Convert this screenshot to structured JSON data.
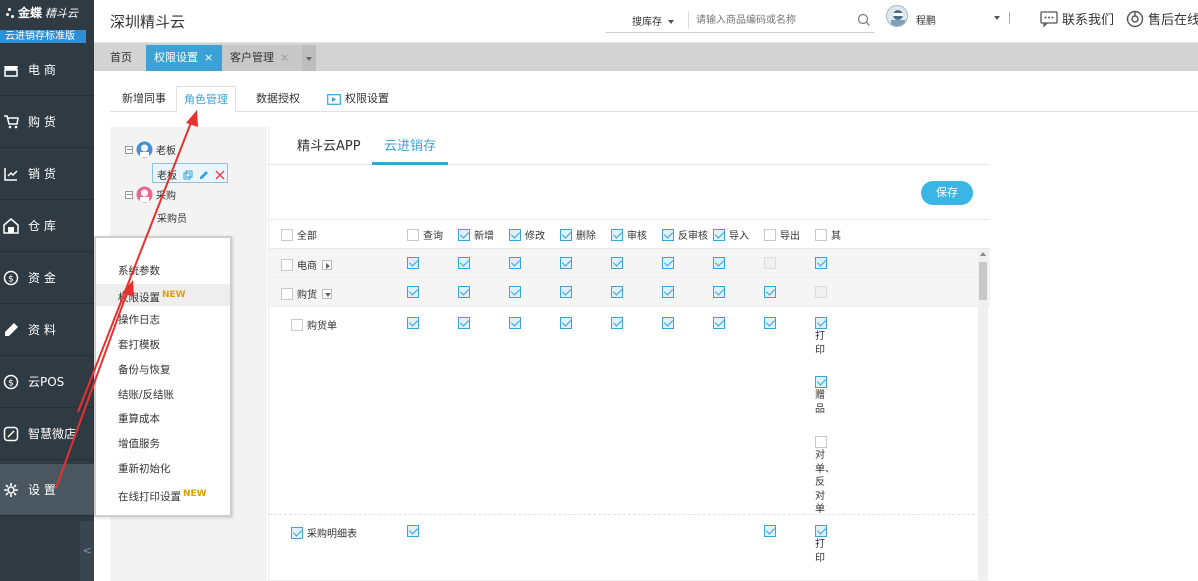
{
  "sidebar": {
    "logo_text": "金蝶",
    "logo_sub": "精斗云",
    "edition": "云进销存标准版",
    "items": [
      {
        "label": "电 商",
        "icon": "shop-icon"
      },
      {
        "label": "购 货",
        "icon": "cart-icon"
      },
      {
        "label": "销 货",
        "icon": "sales-icon"
      },
      {
        "label": "仓 库",
        "icon": "warehouse-icon"
      },
      {
        "label": "资 金",
        "icon": "money-icon"
      },
      {
        "label": "资 料",
        "icon": "pencil-icon"
      },
      {
        "label": "云POS",
        "icon": "pos-icon"
      },
      {
        "label": "智慧微店",
        "icon": "microstore-icon"
      },
      {
        "label": "设 置",
        "icon": "gear-icon"
      }
    ],
    "collapse_glyph": "<"
  },
  "header": {
    "title": "深圳精斗云",
    "search_scope": "搜库存",
    "search_placeholder": "请输入商品编码或名称",
    "username": "程鹏",
    "separator": "|",
    "contact": "联系我们",
    "aftersales": "售后在线"
  },
  "tabs": {
    "home": "首页",
    "active": "权限设置",
    "inactive": "客户管理",
    "close": "×"
  },
  "subtabs": [
    "新增同事",
    "角色管理",
    "数据授权",
    "权限设置"
  ],
  "tree": {
    "boss": "老板",
    "boss_child": "老板",
    "purchase": "采购",
    "purchase_child": "采购员"
  },
  "settings_menu": {
    "items": [
      {
        "label": "系统参数",
        "new": false
      },
      {
        "label": "权限设置",
        "new": true
      },
      {
        "label": "操作日志",
        "new": false
      },
      {
        "label": "套打模板",
        "new": false
      },
      {
        "label": "备份与恢复",
        "new": false
      },
      {
        "label": "结账/反结账",
        "new": false
      },
      {
        "label": "重算成本",
        "new": false
      },
      {
        "label": "增值服务",
        "new": false
      },
      {
        "label": "重新初始化",
        "new": false
      },
      {
        "label": "在线打印设置",
        "new": true
      }
    ],
    "new_badge": "NEW"
  },
  "panel": {
    "tabs": [
      "精斗云APP",
      "云进销存"
    ],
    "active_tab": "云进销存",
    "save_label": "保存",
    "columns": [
      "全部",
      "查询",
      "新增",
      "修改",
      "删除",
      "审核",
      "反审核",
      "导入",
      "导出",
      "其"
    ],
    "rows": [
      {
        "label": "电商",
        "expander": "collapsed",
        "checks": [
          true,
          true,
          true,
          true,
          true,
          true,
          true,
          "disabled",
          true
        ]
      },
      {
        "label": "购货",
        "expander": "expanded",
        "checks": [
          true,
          true,
          true,
          true,
          true,
          true,
          true,
          true,
          "disabled"
        ]
      },
      {
        "label": "购货单",
        "checks": [
          true,
          true,
          true,
          true,
          true,
          true,
          true,
          true,
          true
        ],
        "extras": [
          "打印",
          "赠品",
          "对单、反对单"
        ],
        "extra_checks": [
          true,
          true,
          false
        ]
      },
      {
        "label": "采购明细表",
        "checks": [
          true,
          false,
          false,
          false,
          false,
          false,
          false,
          true,
          true
        ],
        "extras": [
          "打印"
        ],
        "extra_checks": [
          true
        ]
      }
    ]
  },
  "colors": {
    "sidebar_bg": "#2f3a43",
    "accent": "#3aa2d6",
    "save_button": "#3ab5e6",
    "annotation_arrow": "#e8312f",
    "new_badge": "#e0a000"
  }
}
